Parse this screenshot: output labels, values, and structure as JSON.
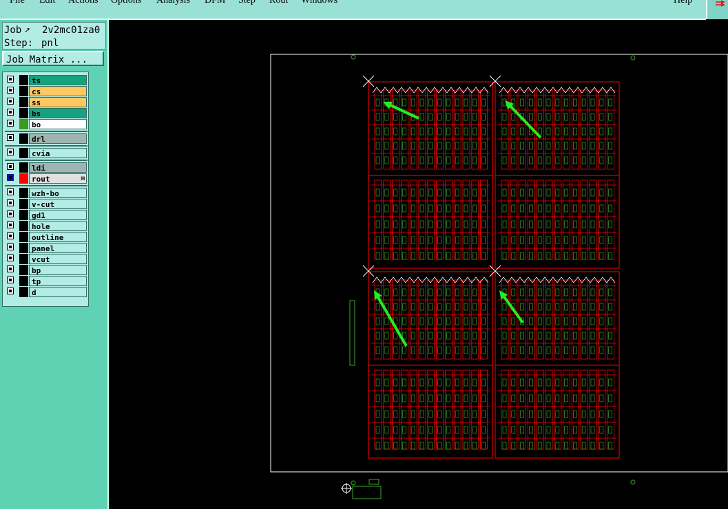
{
  "menu": {
    "items": [
      "File",
      "Edit",
      "Actions",
      "Options",
      "Analysis",
      "DFM",
      "Step",
      "Rout",
      "Windows"
    ],
    "help": "Help"
  },
  "job": {
    "job_label": "Job",
    "job_name": "2v2mc01za0",
    "step_label": "Step:",
    "step_name": "pnl"
  },
  "job_matrix_button": "Job Matrix ...",
  "layers": [
    {
      "name": "ts",
      "color": "#18a27f",
      "swatch": "#000000"
    },
    {
      "name": "cs",
      "color": "#ffc860",
      "swatch": "#000000"
    },
    {
      "name": "ss",
      "color": "#ffc860",
      "swatch": "#000000"
    },
    {
      "name": "bs",
      "color": "#18a27f",
      "swatch": "#000000"
    },
    {
      "name": "bo",
      "color": "#ffffff",
      "swatch": "#3c9a1c"
    },
    {
      "name": "drl",
      "color": "#9fb4b0",
      "swatch": "#000000"
    },
    {
      "name": "cvia",
      "color": "#b3ece4",
      "swatch": "#000000"
    },
    {
      "name": "ldi",
      "color": "#9fb4b0",
      "swatch": "#000000"
    },
    {
      "name": "rout",
      "color": "#e0e0e0",
      "swatch": "#ff0000",
      "active": true
    },
    {
      "name": "wzh-bo",
      "color": "#b3ece4",
      "swatch": "#000000"
    },
    {
      "name": "v-cut",
      "color": "#b3ece4",
      "swatch": "#000000"
    },
    {
      "name": "gd1",
      "color": "#b3ece4",
      "swatch": "#000000"
    },
    {
      "name": "hole",
      "color": "#b3ece4",
      "swatch": "#000000"
    },
    {
      "name": "outline",
      "color": "#b3ece4",
      "swatch": "#000000"
    },
    {
      "name": "panel",
      "color": "#b3ece4",
      "swatch": "#000000"
    },
    {
      "name": "vcut",
      "color": "#b3ece4",
      "swatch": "#000000"
    },
    {
      "name": "bp",
      "color": "#b3ece4",
      "swatch": "#000000"
    },
    {
      "name": "tp",
      "color": "#b3ece4",
      "swatch": "#000000"
    },
    {
      "name": "d",
      "color": "#b3ece4",
      "swatch": "#000000"
    }
  ],
  "colors": {
    "rout": "#ff0000",
    "arrow": "#22ee22",
    "frame": "#ffffff",
    "label": "#3ba82a"
  }
}
